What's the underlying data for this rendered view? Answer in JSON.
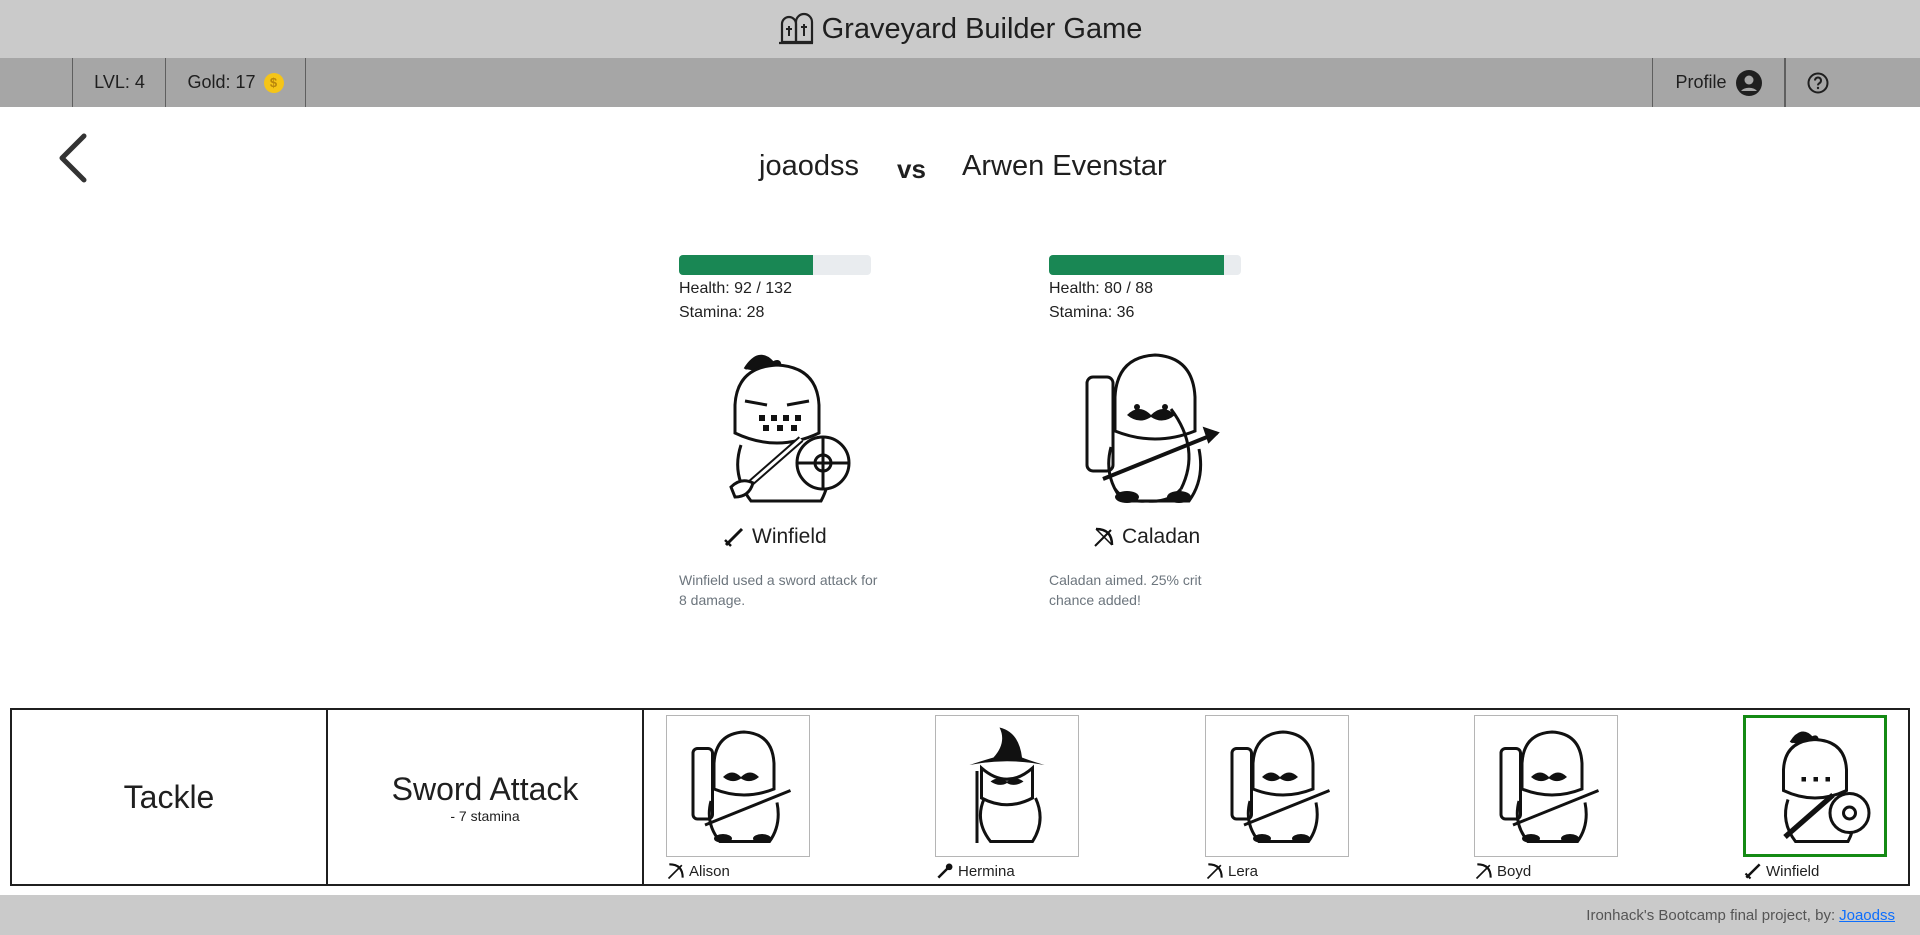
{
  "app": {
    "title": "Graveyard Builder Game",
    "icon": "tombstones-icon"
  },
  "stats": {
    "level": "LVL: 4",
    "gold": "Gold: 17",
    "coin_icon": "coin-icon"
  },
  "nav": {
    "profile_label": "Profile",
    "profile_icon": "user-circle-icon",
    "help_icon": "question-circle-icon"
  },
  "battle": {
    "player": "joaodss",
    "vs": "vs",
    "opponent": "Arwen Evenstar",
    "left": {
      "health_fraction": 0.697,
      "health_text": "Health: 92 / 132",
      "stamina_text": "Stamina: 28",
      "name": "Winfield",
      "class_icon": "sword-icon",
      "log": "Winfield used a sword attack for 8 damage."
    },
    "right": {
      "health_fraction": 0.909,
      "health_text": "Health: 80 / 88",
      "stamina_text": "Stamina: 36",
      "name": "Caladan",
      "class_icon": "bow-icon",
      "log": "Caladan aimed. 25% crit chance added!"
    }
  },
  "moves": [
    {
      "name": "Tackle",
      "cost": ""
    },
    {
      "name": "Sword Attack",
      "cost": "- 7 stamina"
    }
  ],
  "team": [
    {
      "name": "Alison",
      "icon": "bow-icon",
      "active": false
    },
    {
      "name": "Hermina",
      "icon": "staff-icon",
      "active": false
    },
    {
      "name": "Lera",
      "icon": "bow-icon",
      "active": false
    },
    {
      "name": "Boyd",
      "icon": "bow-icon",
      "active": false
    },
    {
      "name": "Winfield",
      "icon": "sword-icon",
      "active": true
    }
  ],
  "footer": {
    "text": "Ironhack's Bootcamp final project, by:",
    "link": "Joaodss"
  },
  "colors": {
    "health": "#198754",
    "active_border": "#148a14",
    "topbar": "#cacaca",
    "navbar": "#a6a6a6"
  }
}
